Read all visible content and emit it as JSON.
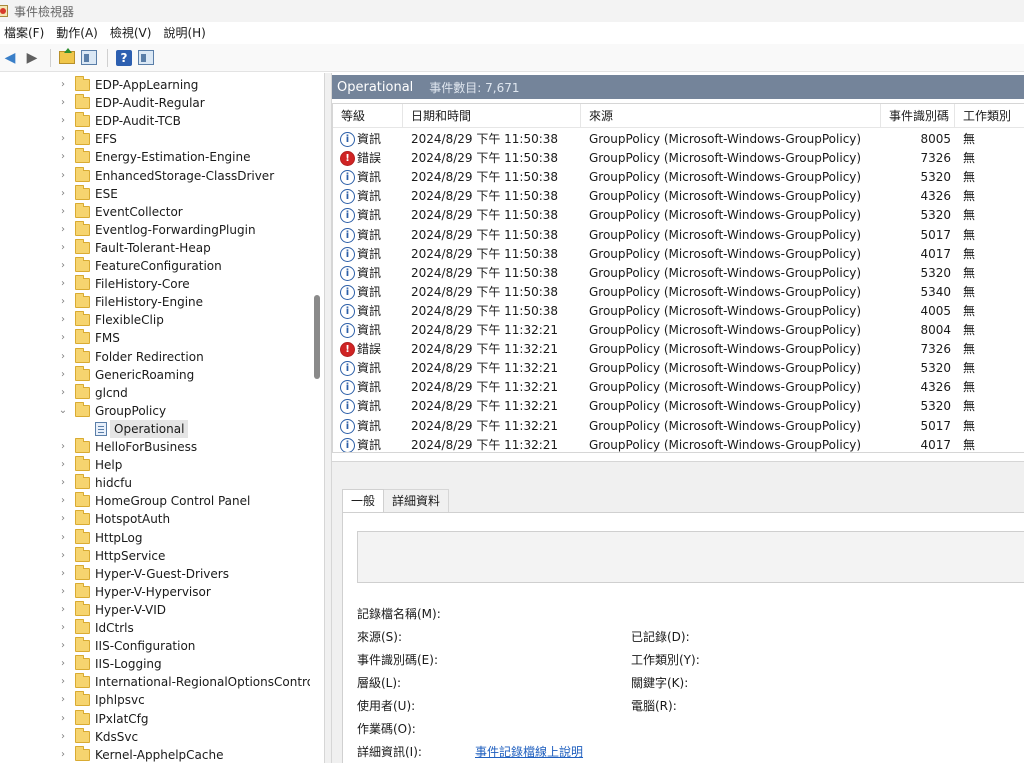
{
  "window": {
    "title": "事件檢視器"
  },
  "menu": [
    "檔案(F)",
    "動作(A)",
    "檢視(V)",
    "說明(H)"
  ],
  "toolbar": {
    "icons": [
      "back-arrow-icon",
      "forward-arrow-icon",
      "folder-up-icon",
      "properties-icon",
      "help-icon",
      "show-pane-icon"
    ]
  },
  "tree": {
    "items": [
      {
        "label": "EDP-AppLearning",
        "expanded": false
      },
      {
        "label": "EDP-Audit-Regular",
        "expanded": false
      },
      {
        "label": "EDP-Audit-TCB",
        "expanded": false
      },
      {
        "label": "EFS",
        "expanded": false
      },
      {
        "label": "Energy-Estimation-Engine",
        "expanded": false
      },
      {
        "label": "EnhancedStorage-ClassDriver",
        "expanded": false
      },
      {
        "label": "ESE",
        "expanded": false
      },
      {
        "label": "EventCollector",
        "expanded": false
      },
      {
        "label": "Eventlog-ForwardingPlugin",
        "expanded": false
      },
      {
        "label": "Fault-Tolerant-Heap",
        "expanded": false
      },
      {
        "label": "FeatureConfiguration",
        "expanded": false
      },
      {
        "label": "FileHistory-Core",
        "expanded": false
      },
      {
        "label": "FileHistory-Engine",
        "expanded": false
      },
      {
        "label": "FlexibleClip",
        "expanded": false
      },
      {
        "label": "FMS",
        "expanded": false
      },
      {
        "label": "Folder Redirection",
        "expanded": false
      },
      {
        "label": "GenericRoaming",
        "expanded": false
      },
      {
        "label": "glcnd",
        "expanded": false
      },
      {
        "label": "GroupPolicy",
        "expanded": true
      },
      {
        "label": "Operational",
        "child": true,
        "selected": true
      },
      {
        "label": "HelloForBusiness",
        "expanded": false
      },
      {
        "label": "Help",
        "expanded": false
      },
      {
        "label": "hidcfu",
        "expanded": false
      },
      {
        "label": "HomeGroup Control Panel",
        "expanded": false
      },
      {
        "label": "HotspotAuth",
        "expanded": false
      },
      {
        "label": "HttpLog",
        "expanded": false
      },
      {
        "label": "HttpService",
        "expanded": false
      },
      {
        "label": "Hyper-V-Guest-Drivers",
        "expanded": false
      },
      {
        "label": "Hyper-V-Hypervisor",
        "expanded": false
      },
      {
        "label": "Hyper-V-VID",
        "expanded": false
      },
      {
        "label": "IdCtrls",
        "expanded": false
      },
      {
        "label": "IIS-Configuration",
        "expanded": false
      },
      {
        "label": "IIS-Logging",
        "expanded": false
      },
      {
        "label": "International-RegionalOptionsControlP",
        "expanded": false
      },
      {
        "label": "Iphlpsvc",
        "expanded": false
      },
      {
        "label": "IPxlatCfg",
        "expanded": false
      },
      {
        "label": "KdsSvc",
        "expanded": false
      },
      {
        "label": "Kernel-ApphelpCache",
        "expanded": false
      }
    ]
  },
  "log": {
    "name": "Operational",
    "count_text": "事件數目: 7,671",
    "columns": {
      "level": "等級",
      "datetime": "日期和時間",
      "source": "來源",
      "event_id": "事件識別碼",
      "task": "工作類別"
    },
    "rows": [
      {
        "type": "info",
        "level": "資訊",
        "datetime": "2024/8/29 下午 11:50:38",
        "source": "GroupPolicy (Microsoft-Windows-GroupPolicy)",
        "event_id": "8005",
        "task": "無"
      },
      {
        "type": "error",
        "level": "錯誤",
        "datetime": "2024/8/29 下午 11:50:38",
        "source": "GroupPolicy (Microsoft-Windows-GroupPolicy)",
        "event_id": "7326",
        "task": "無"
      },
      {
        "type": "info",
        "level": "資訊",
        "datetime": "2024/8/29 下午 11:50:38",
        "source": "GroupPolicy (Microsoft-Windows-GroupPolicy)",
        "event_id": "5320",
        "task": "無"
      },
      {
        "type": "info",
        "level": "資訊",
        "datetime": "2024/8/29 下午 11:50:38",
        "source": "GroupPolicy (Microsoft-Windows-GroupPolicy)",
        "event_id": "4326",
        "task": "無"
      },
      {
        "type": "info",
        "level": "資訊",
        "datetime": "2024/8/29 下午 11:50:38",
        "source": "GroupPolicy (Microsoft-Windows-GroupPolicy)",
        "event_id": "5320",
        "task": "無"
      },
      {
        "type": "info",
        "level": "資訊",
        "datetime": "2024/8/29 下午 11:50:38",
        "source": "GroupPolicy (Microsoft-Windows-GroupPolicy)",
        "event_id": "5017",
        "task": "無"
      },
      {
        "type": "info",
        "level": "資訊",
        "datetime": "2024/8/29 下午 11:50:38",
        "source": "GroupPolicy (Microsoft-Windows-GroupPolicy)",
        "event_id": "4017",
        "task": "無"
      },
      {
        "type": "info",
        "level": "資訊",
        "datetime": "2024/8/29 下午 11:50:38",
        "source": "GroupPolicy (Microsoft-Windows-GroupPolicy)",
        "event_id": "5320",
        "task": "無"
      },
      {
        "type": "info",
        "level": "資訊",
        "datetime": "2024/8/29 下午 11:50:38",
        "source": "GroupPolicy (Microsoft-Windows-GroupPolicy)",
        "event_id": "5340",
        "task": "無"
      },
      {
        "type": "info",
        "level": "資訊",
        "datetime": "2024/8/29 下午 11:50:38",
        "source": "GroupPolicy (Microsoft-Windows-GroupPolicy)",
        "event_id": "4005",
        "task": "無"
      },
      {
        "type": "info",
        "level": "資訊",
        "datetime": "2024/8/29 下午 11:32:21",
        "source": "GroupPolicy (Microsoft-Windows-GroupPolicy)",
        "event_id": "8004",
        "task": "無"
      },
      {
        "type": "error",
        "level": "錯誤",
        "datetime": "2024/8/29 下午 11:32:21",
        "source": "GroupPolicy (Microsoft-Windows-GroupPolicy)",
        "event_id": "7326",
        "task": "無"
      },
      {
        "type": "info",
        "level": "資訊",
        "datetime": "2024/8/29 下午 11:32:21",
        "source": "GroupPolicy (Microsoft-Windows-GroupPolicy)",
        "event_id": "5320",
        "task": "無"
      },
      {
        "type": "info",
        "level": "資訊",
        "datetime": "2024/8/29 下午 11:32:21",
        "source": "GroupPolicy (Microsoft-Windows-GroupPolicy)",
        "event_id": "4326",
        "task": "無"
      },
      {
        "type": "info",
        "level": "資訊",
        "datetime": "2024/8/29 下午 11:32:21",
        "source": "GroupPolicy (Microsoft-Windows-GroupPolicy)",
        "event_id": "5320",
        "task": "無"
      },
      {
        "type": "info",
        "level": "資訊",
        "datetime": "2024/8/29 下午 11:32:21",
        "source": "GroupPolicy (Microsoft-Windows-GroupPolicy)",
        "event_id": "5017",
        "task": "無"
      },
      {
        "type": "info",
        "level": "資訊",
        "datetime": "2024/8/29 下午 11:32:21",
        "source": "GroupPolicy (Microsoft-Windows-GroupPolicy)",
        "event_id": "4017",
        "task": "無"
      }
    ]
  },
  "details": {
    "tabs": [
      "一般",
      "詳細資料"
    ],
    "active_tab": "一般",
    "fields": {
      "log_name": "記錄檔名稱(M):",
      "source": "來源(S):",
      "logged": "已記錄(D):",
      "event_id": "事件識別碼(E):",
      "task_category": "工作類別(Y):",
      "level": "層級(L):",
      "keywords": "關鍵字(K):",
      "user": "使用者(U):",
      "computer": "電腦(R):",
      "opcode": "作業碼(O):",
      "more_info": "詳細資訊(I):"
    },
    "help_link": "事件記錄檔線上說明"
  },
  "colors": {
    "header_bar": "#74849a",
    "info_icon": "#2c5fa8",
    "error_icon": "#d02424",
    "link": "#1f5fbf"
  }
}
